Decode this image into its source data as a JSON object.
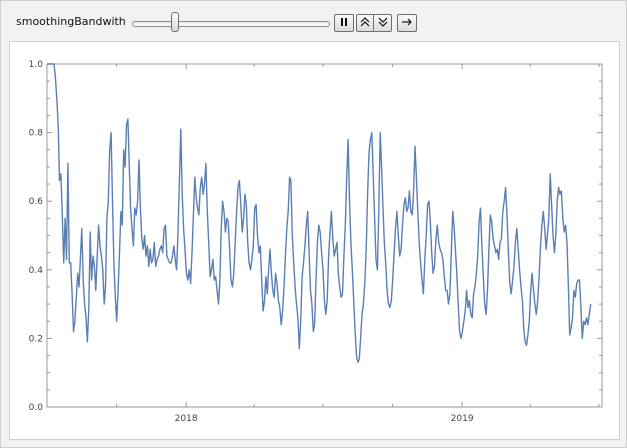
{
  "controls": {
    "label": "smoothingBandwith",
    "slider_value": 0.22,
    "pause_glyph": "⏸",
    "faster_glyph": "≈",
    "slower_glyph": "≈",
    "step_glyph": "→"
  },
  "colors": {
    "line": "#5b7fb4",
    "axis": "#999999",
    "panel": "#ffffff",
    "background": "#f2f2f2"
  },
  "chart_data": {
    "type": "line",
    "title": "",
    "xlabel": "",
    "ylabel": "",
    "ylim": [
      0,
      1.0
    ],
    "yticks": [
      "0.0",
      "0.2",
      "0.4",
      "0.6",
      "0.8",
      "1.0"
    ],
    "xlim": [
      "2017-07-01",
      "2019-07-05"
    ],
    "xticks": [
      {
        "label": "2018",
        "date": "2018-01-01"
      },
      {
        "label": "2019",
        "date": "2019-01-01"
      }
    ],
    "grid": false,
    "series": [
      {
        "x_start": "2017-07-01",
        "x_end": "2019-06-20",
        "values": [
          1.0,
          1.0,
          1.0,
          1.0,
          1.0,
          1.0,
          0.96,
          0.9,
          0.82,
          0.66,
          0.68,
          0.56,
          0.42,
          0.55,
          0.43,
          0.71,
          0.42,
          0.42,
          0.33,
          0.22,
          0.25,
          0.32,
          0.39,
          0.35,
          0.44,
          0.52,
          0.37,
          0.3,
          0.26,
          0.19,
          0.29,
          0.51,
          0.37,
          0.44,
          0.41,
          0.34,
          0.44,
          0.53,
          0.47,
          0.44,
          0.4,
          0.3,
          0.35,
          0.55,
          0.6,
          0.75,
          0.8,
          0.6,
          0.42,
          0.32,
          0.25,
          0.34,
          0.45,
          0.57,
          0.53,
          0.75,
          0.7,
          0.82,
          0.84,
          0.71,
          0.58,
          0.52,
          0.47,
          0.58,
          0.56,
          0.6,
          0.72,
          0.58,
          0.49,
          0.46,
          0.5,
          0.44,
          0.47,
          0.41,
          0.46,
          0.42,
          0.43,
          0.48,
          0.41,
          0.43,
          0.44,
          0.46,
          0.47,
          0.45,
          0.52,
          0.53,
          0.44,
          0.43,
          0.42,
          0.42,
          0.44,
          0.47,
          0.43,
          0.4,
          0.51,
          0.66,
          0.81,
          0.62,
          0.52,
          0.46,
          0.39,
          0.37,
          0.4,
          0.36,
          0.45,
          0.56,
          0.67,
          0.61,
          0.58,
          0.56,
          0.64,
          0.67,
          0.62,
          0.65,
          0.71,
          0.57,
          0.48,
          0.38,
          0.4,
          0.43,
          0.37,
          0.38,
          0.34,
          0.3,
          0.37,
          0.52,
          0.6,
          0.57,
          0.51,
          0.55,
          0.54,
          0.46,
          0.37,
          0.35,
          0.39,
          0.48,
          0.57,
          0.64,
          0.66,
          0.59,
          0.51,
          0.55,
          0.62,
          0.59,
          0.48,
          0.42,
          0.4,
          0.43,
          0.47,
          0.58,
          0.59,
          0.5,
          0.45,
          0.47,
          0.37,
          0.28,
          0.31,
          0.38,
          0.33,
          0.4,
          0.46,
          0.39,
          0.34,
          0.32,
          0.39,
          0.36,
          0.31,
          0.29,
          0.24,
          0.28,
          0.35,
          0.44,
          0.52,
          0.57,
          0.67,
          0.66,
          0.5,
          0.42,
          0.35,
          0.3,
          0.26,
          0.17,
          0.25,
          0.38,
          0.42,
          0.47,
          0.53,
          0.57,
          0.45,
          0.34,
          0.3,
          0.22,
          0.24,
          0.37,
          0.48,
          0.53,
          0.51,
          0.45,
          0.4,
          0.31,
          0.27,
          0.31,
          0.44,
          0.51,
          0.57,
          0.49,
          0.44,
          0.46,
          0.48,
          0.39,
          0.35,
          0.32,
          0.33,
          0.44,
          0.53,
          0.67,
          0.78,
          0.6,
          0.48,
          0.4,
          0.31,
          0.22,
          0.15,
          0.13,
          0.14,
          0.2,
          0.27,
          0.3,
          0.36,
          0.46,
          0.62,
          0.74,
          0.78,
          0.8,
          0.68,
          0.55,
          0.43,
          0.4,
          0.57,
          0.8,
          0.7,
          0.58,
          0.48,
          0.42,
          0.34,
          0.3,
          0.29,
          0.31,
          0.37,
          0.45,
          0.52,
          0.57,
          0.5,
          0.44,
          0.46,
          0.53,
          0.59,
          0.61,
          0.57,
          0.58,
          0.63,
          0.57,
          0.56,
          0.63,
          0.76,
          0.67,
          0.57,
          0.48,
          0.42,
          0.37,
          0.33,
          0.43,
          0.5,
          0.59,
          0.6,
          0.54,
          0.45,
          0.39,
          0.41,
          0.49,
          0.53,
          0.48,
          0.46,
          0.45,
          0.43,
          0.38,
          0.34,
          0.34,
          0.3,
          0.33,
          0.45,
          0.57,
          0.53,
          0.46,
          0.39,
          0.3,
          0.22,
          0.2,
          0.22,
          0.25,
          0.28,
          0.34,
          0.29,
          0.31,
          0.27,
          0.26,
          0.33,
          0.35,
          0.39,
          0.44,
          0.54,
          0.58,
          0.47,
          0.38,
          0.3,
          0.27,
          0.34,
          0.46,
          0.56,
          0.54,
          0.49,
          0.47,
          0.45,
          0.46,
          0.43,
          0.48,
          0.49,
          0.57,
          0.6,
          0.64,
          0.56,
          0.45,
          0.36,
          0.33,
          0.37,
          0.41,
          0.48,
          0.52,
          0.46,
          0.4,
          0.35,
          0.31,
          0.23,
          0.19,
          0.18,
          0.21,
          0.25,
          0.34,
          0.39,
          0.34,
          0.3,
          0.27,
          0.31,
          0.38,
          0.47,
          0.53,
          0.57,
          0.52,
          0.46,
          0.5,
          0.55,
          0.68,
          0.59,
          0.5,
          0.45,
          0.5,
          0.6,
          0.64,
          0.62,
          0.63,
          0.55,
          0.51,
          0.53,
          0.48,
          0.35,
          0.21,
          0.23,
          0.26,
          0.34,
          0.32,
          0.36,
          0.37,
          0.37,
          0.29,
          0.2,
          0.25,
          0.24,
          0.26,
          0.24,
          0.27,
          0.3
        ]
      }
    ]
  }
}
